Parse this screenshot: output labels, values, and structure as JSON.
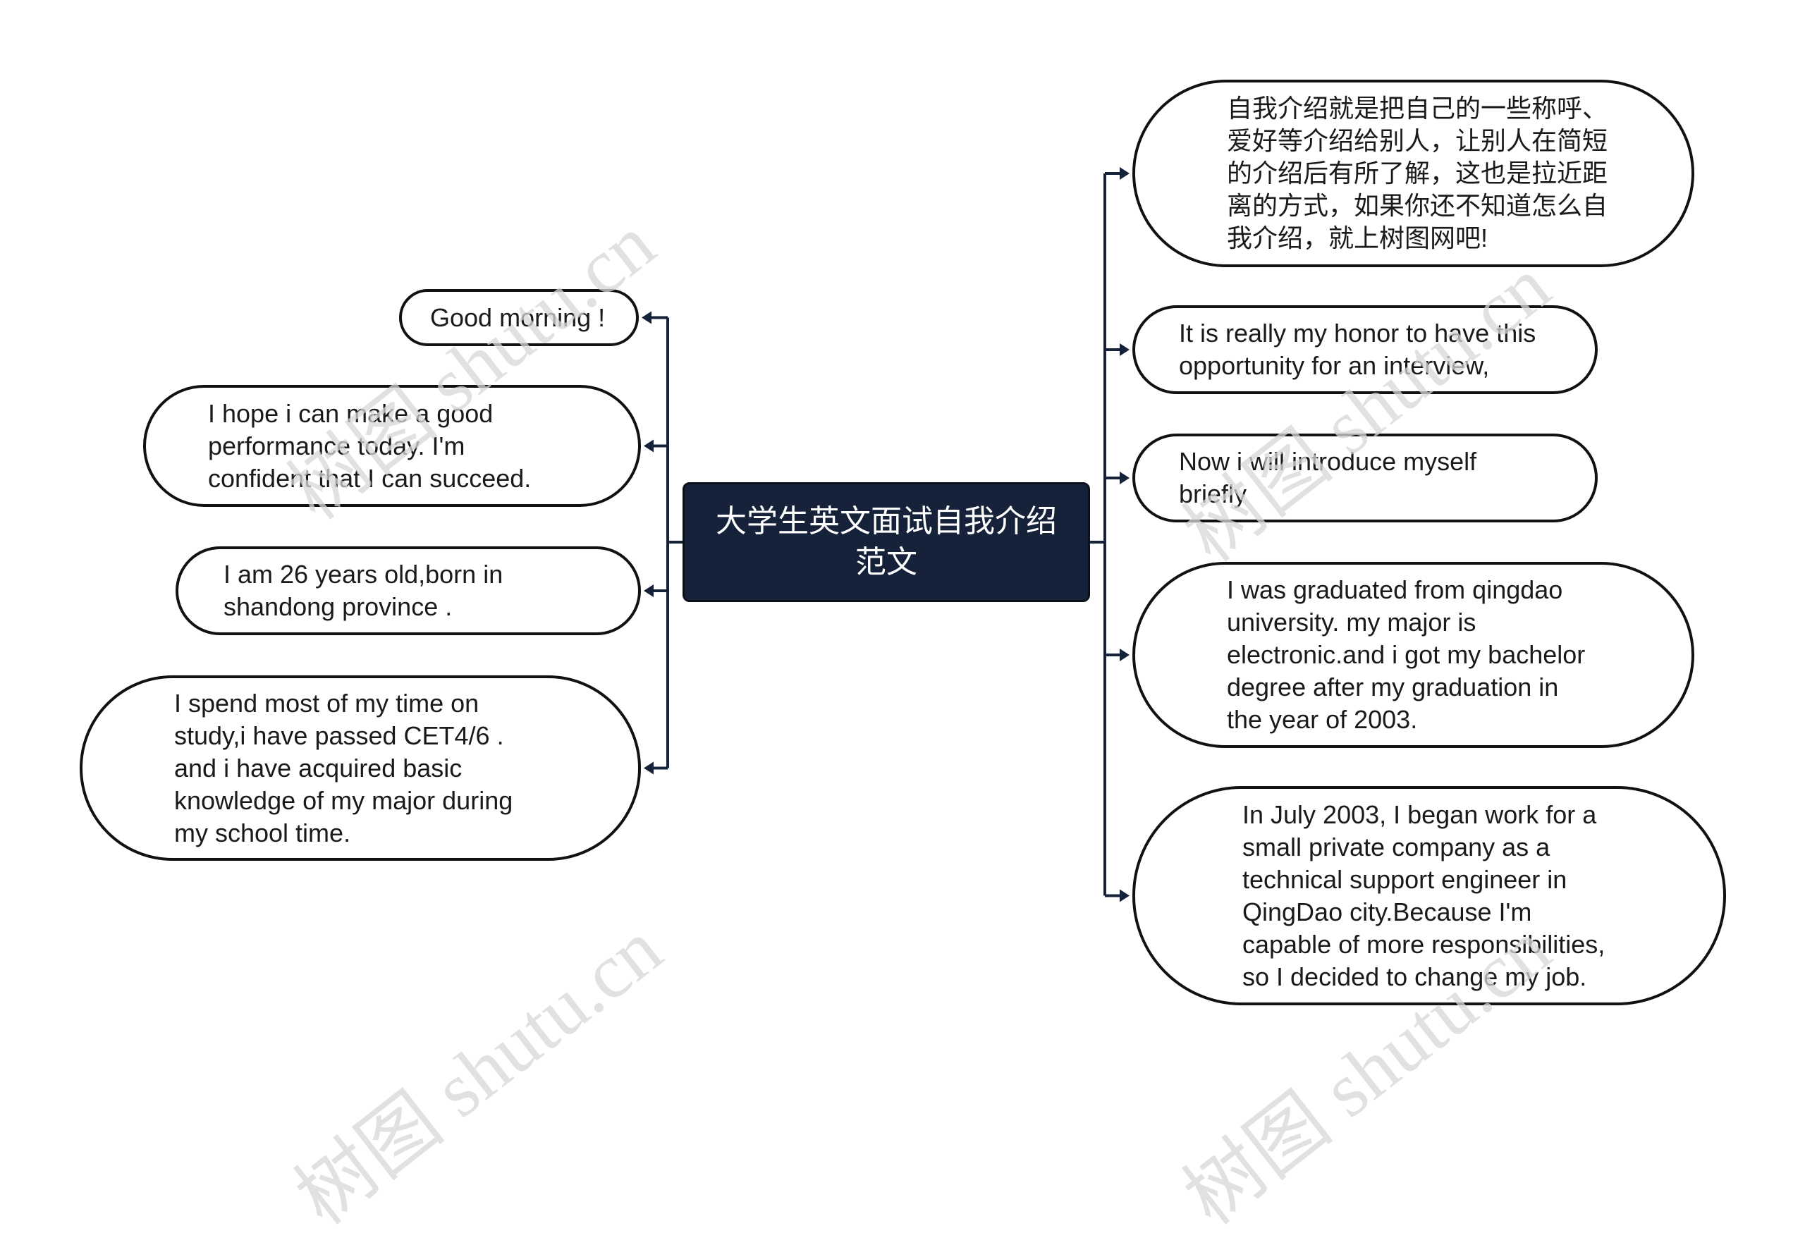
{
  "diagram": {
    "type": "mind-map",
    "central_topic": "大学生英文面试自我介绍范文",
    "colors": {
      "central_fill": "#16213a",
      "central_text": "#ffffff",
      "node_border": "#111111",
      "node_fill": "#ffffff",
      "connector": "#16213a",
      "watermark": "#d8d8d8"
    },
    "left_branches": [
      {
        "id": "l1",
        "text": "Good morning !"
      },
      {
        "id": "l2",
        "text": "I hope i can make a good\nperformance today. I'm\nconfident that I can succeed."
      },
      {
        "id": "l3",
        "text": "I am 26 years old,born in\nshandong province ."
      },
      {
        "id": "l4",
        "text": "I spend most of my time on\nstudy,i have passed CET4/6 .\nand i have acquired basic\nknowledge of my major during\nmy school time."
      }
    ],
    "right_branches": [
      {
        "id": "r1",
        "text": "自我介绍就是把自己的一些称呼、\n爱好等介绍给别人，让别人在简短\n的介绍后有所了解，这也是拉近距\n离的方式，如果你还不知道怎么自\n我介绍，就上树图网吧!"
      },
      {
        "id": "r2",
        "text": "It is really my honor to have this\n opportunity for an interview,"
      },
      {
        "id": "r3",
        "text": "Now i will introduce myself\nbriefly"
      },
      {
        "id": "r4",
        "text": "I was graduated from qingdao\nuniversity. my major is\nelectronic.and i got my bachelor\n degree after my graduation in\nthe year of 2003."
      },
      {
        "id": "r5",
        "text": "In July 2003, I began work for a\nsmall private company as a\ntechnical support engineer in\nQingDao city.Because I'm\ncapable of more responsibilities,\n so I decided to change my job."
      }
    ],
    "watermarks": [
      "树图 shutu.cn",
      "树图 shutu.cn",
      "树图 shutu.cn",
      "树图 shutu.cn"
    ]
  }
}
